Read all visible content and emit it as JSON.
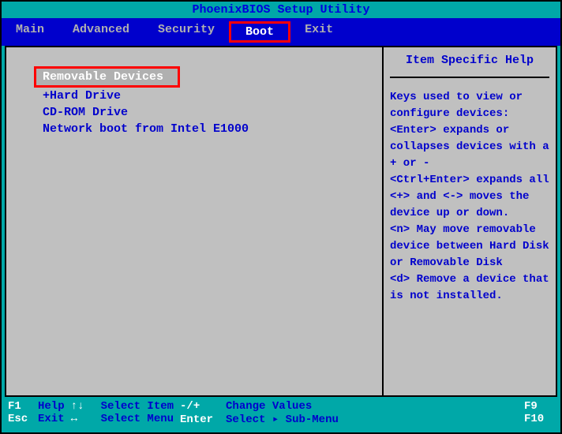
{
  "title": "PhoenixBIOS Setup Utility",
  "menu": {
    "items": [
      "Main",
      "Advanced",
      "Security",
      "Boot",
      "Exit"
    ],
    "active_index": 3
  },
  "boot_devices": {
    "items": [
      "Removable Devices",
      "Hard Drive",
      "CD-ROM Drive",
      "Network boot from Intel E1000"
    ],
    "selected_index": 0,
    "expandable_prefix": "+"
  },
  "help": {
    "title": "Item Specific Help",
    "text": "Keys used to view or configure devices:\n<Enter> expands or collapses devices with a + or -\n<Ctrl+Enter> expands all\n<+> and <-> moves the device up or down.\n<n> May move removable device between Hard Disk or Removable Disk\n<d> Remove a device that is not installed."
  },
  "footer": {
    "f1": {
      "key": "F1",
      "label": "Help"
    },
    "esc": {
      "key": "Esc",
      "label": "Exit"
    },
    "updown": {
      "key": "↑↓",
      "label": "Select Item"
    },
    "leftright": {
      "key": "↔",
      "label": "Select Menu"
    },
    "plusminus": {
      "key": "-/+",
      "label": "Change Values"
    },
    "enter": {
      "key": "Enter",
      "label": "Select ▸ Sub-Menu"
    },
    "f9": {
      "key": "F9",
      "label": ""
    },
    "f10": {
      "key": "F10",
      "label": ""
    }
  }
}
